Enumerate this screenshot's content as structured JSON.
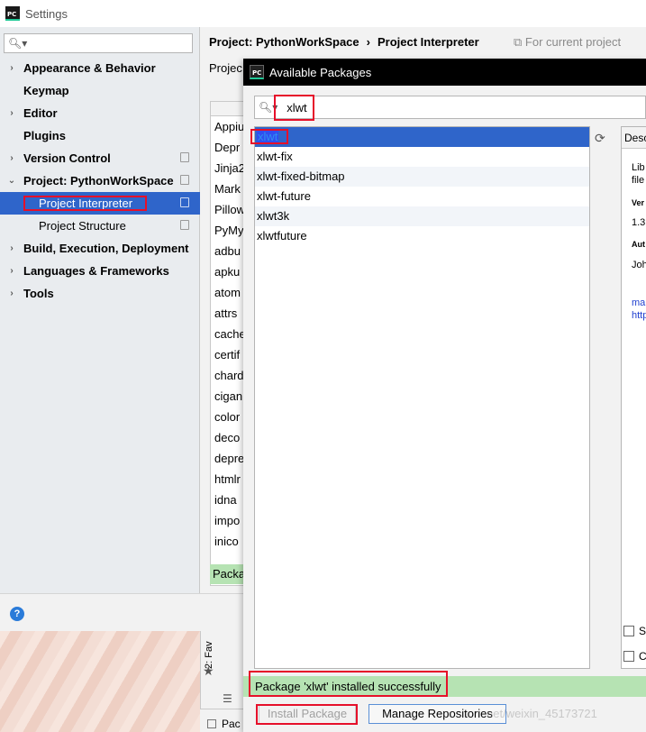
{
  "window": {
    "title": "Settings"
  },
  "sidebar": {
    "search_placeholder": "",
    "items": [
      {
        "label": "Appearance & Behavior",
        "arrow": "›"
      },
      {
        "label": "Keymap",
        "arrow": ""
      },
      {
        "label": "Editor",
        "arrow": "›"
      },
      {
        "label": "Plugins",
        "arrow": ""
      },
      {
        "label": "Version Control",
        "arrow": "›"
      },
      {
        "label": "Project: PythonWorkSpace",
        "arrow": "⌄"
      },
      {
        "label": "Project Interpreter",
        "arrow": ""
      },
      {
        "label": "Project Structure",
        "arrow": ""
      },
      {
        "label": "Build, Execution, Deployment",
        "arrow": "›"
      },
      {
        "label": "Languages & Frameworks",
        "arrow": "›"
      },
      {
        "label": "Tools",
        "arrow": "›"
      }
    ]
  },
  "content": {
    "breadcrumb_project": "Project: PythonWorkSpace",
    "breadcrumb_sep": "›",
    "breadcrumb_page": "Project Interpreter",
    "for_current_project": "For current project",
    "project_label": "Projec",
    "packages": [
      "Appiu",
      "Depr",
      "Jinja2",
      "Mark",
      "Pillow",
      "PyMy",
      "adbu",
      "apku",
      "atom",
      "attrs",
      "cache",
      "certif",
      "chard",
      "cigan",
      "color",
      "deco",
      "depre",
      "htmlr",
      "idna",
      "impo",
      "inico"
    ],
    "status_truncated": "Packa"
  },
  "dialog": {
    "title": "Available Packages",
    "search_value": "xlwt",
    "results": [
      "xlwt",
      "xlwt-fix",
      "xlwt-fixed-bitmap",
      "xlwt-future",
      "xlwt3k",
      "xlwtfuture"
    ],
    "description_header": "Desc",
    "description_lines": [
      "Lib",
      "file",
      "Ver",
      "1.3",
      "Aut",
      "Joh",
      "ma",
      "http"
    ],
    "option_1": "S",
    "option_2": "C",
    "status_message": "Package 'xlwt' installed successfully",
    "install_button": "Install Package",
    "manage_button": "Manage Repositories",
    "watermark": "net/weixin_45173721"
  },
  "bottom": {
    "help": "?",
    "favorites_tab": "2: Fav",
    "packages_tab": "Pac"
  },
  "icons": {
    "logo": "pycharm-logo-icon",
    "search": "search-icon",
    "reload": "reload-icon",
    "copy": "copy-icon",
    "help": "help-icon",
    "star": "star-icon"
  },
  "colors": {
    "selection": "#2f65ca",
    "success": "#b6e3b3",
    "annotation": "#e6102a",
    "link": "#1f3fcf"
  }
}
